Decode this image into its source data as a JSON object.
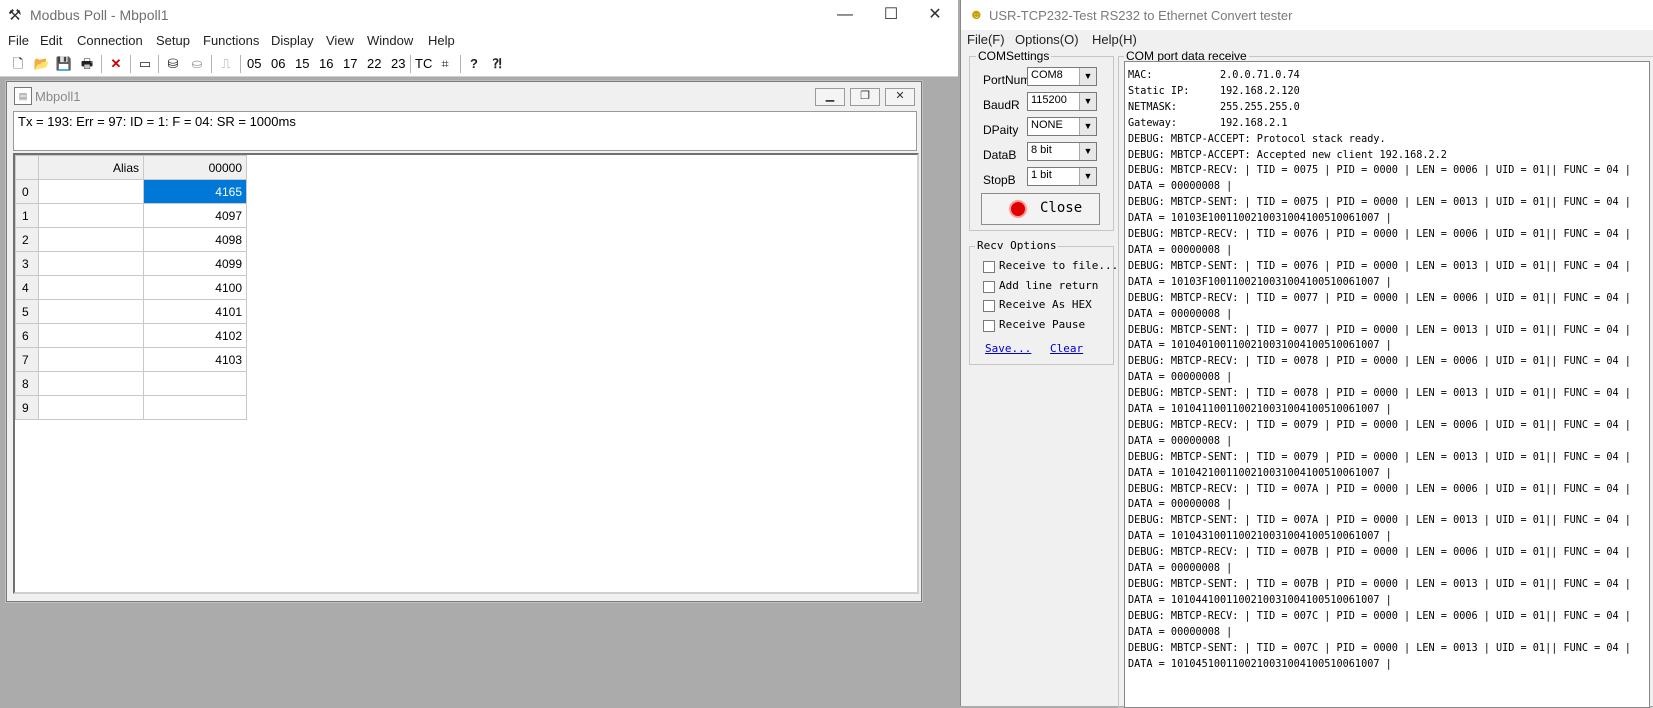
{
  "modbus_poll": {
    "title": "Modbus Poll - Mbpoll1",
    "menu": [
      "File",
      "Edit",
      "Connection",
      "Setup",
      "Functions",
      "Display",
      "View",
      "Window",
      "Help"
    ],
    "toolbar_codes": [
      "05",
      "06",
      "15",
      "16",
      "17",
      "22",
      "23"
    ],
    "toolbar_tc": "TC",
    "child": {
      "title": "Mbpoll1",
      "status": "Tx = 193: Err = 97: ID = 1: F = 04: SR = 1000ms",
      "grid": {
        "headers": [
          "Alias",
          "00000"
        ],
        "rows": [
          {
            "num": "0",
            "alias": "",
            "value": "4165"
          },
          {
            "num": "1",
            "alias": "",
            "value": "4097"
          },
          {
            "num": "2",
            "alias": "",
            "value": "4098"
          },
          {
            "num": "3",
            "alias": "",
            "value": "4099"
          },
          {
            "num": "4",
            "alias": "",
            "value": "4100"
          },
          {
            "num": "5",
            "alias": "",
            "value": "4101"
          },
          {
            "num": "6",
            "alias": "",
            "value": "4102"
          },
          {
            "num": "7",
            "alias": "",
            "value": "4103"
          },
          {
            "num": "8",
            "alias": "",
            "value": ""
          },
          {
            "num": "9",
            "alias": "",
            "value": ""
          }
        ]
      }
    }
  },
  "usr_tcp": {
    "title": "USR-TCP232-Test  RS232 to Ethernet Convert tester",
    "menu": [
      "File(F)",
      "Options(O)",
      "Help(H)"
    ],
    "com_settings": {
      "label": "COMSettings",
      "fields": [
        {
          "label": "PortNum",
          "value": "COM8"
        },
        {
          "label": "BaudR",
          "value": "115200"
        },
        {
          "label": "DPaity",
          "value": "NONE"
        },
        {
          "label": "DataB",
          "value": "8 bit"
        },
        {
          "label": "StopB",
          "value": "1 bit"
        }
      ],
      "close_label": "Close"
    },
    "recv_options": {
      "label": "Recv Options",
      "checkboxes": [
        "Receive to file...",
        "Add line return",
        "Receive As HEX",
        "Receive Pause"
      ],
      "save_link": "Save...",
      "clear_link": "Clear"
    },
    "com_recv": {
      "label": "COM port data receive",
      "lines": [
        "MAC:           2.0.0.71.0.74",
        "Static IP:     192.168.2.120",
        "NETMASK:       255.255.255.0",
        "Gateway:       192.168.2.1",
        "DEBUG: MBTCP-ACCEPT: Protocol stack ready.",
        "DEBUG: MBTCP-ACCEPT: Accepted new client 192.168.2.2",
        "DEBUG: MBTCP-RECV: | TID = 0075 | PID = 0000 | LEN = 0006 | UID = 01|| FUNC = 04 |",
        "DATA = 00000008 |",
        "DEBUG: MBTCP-SENT: | TID = 0075 | PID = 0000 | LEN = 0013 | UID = 01|| FUNC = 04 |",
        "DATA = 10103E1001100210031004100510061007 |",
        "DEBUG: MBTCP-RECV: | TID = 0076 | PID = 0000 | LEN = 0006 | UID = 01|| FUNC = 04 |",
        "DATA = 00000008 |",
        "DEBUG: MBTCP-SENT: | TID = 0076 | PID = 0000 | LEN = 0013 | UID = 01|| FUNC = 04 |",
        "DATA = 10103F1001100210031004100510061007 |",
        "DEBUG: MBTCP-RECV: | TID = 0077 | PID = 0000 | LEN = 0006 | UID = 01|| FUNC = 04 |",
        "DATA = 00000008 |",
        "DEBUG: MBTCP-SENT: | TID = 0077 | PID = 0000 | LEN = 0013 | UID = 01|| FUNC = 04 |",
        "DATA = 1010401001100210031004100510061007 |",
        "DEBUG: MBTCP-RECV: | TID = 0078 | PID = 0000 | LEN = 0006 | UID = 01|| FUNC = 04 |",
        "DATA = 00000008 |",
        "DEBUG: MBTCP-SENT: | TID = 0078 | PID = 0000 | LEN = 0013 | UID = 01|| FUNC = 04 |",
        "DATA = 1010411001100210031004100510061007 |",
        "DEBUG: MBTCP-RECV: | TID = 0079 | PID = 0000 | LEN = 0006 | UID = 01|| FUNC = 04 |",
        "DATA = 00000008 |",
        "DEBUG: MBTCP-SENT: | TID = 0079 | PID = 0000 | LEN = 0013 | UID = 01|| FUNC = 04 |",
        "DATA = 1010421001100210031004100510061007 |",
        "DEBUG: MBTCP-RECV: | TID = 007A | PID = 0000 | LEN = 0006 | UID = 01|| FUNC = 04 |",
        "DATA = 00000008 |",
        "DEBUG: MBTCP-SENT: | TID = 007A | PID = 0000 | LEN = 0013 | UID = 01|| FUNC = 04 |",
        "DATA = 1010431001100210031004100510061007 |",
        "DEBUG: MBTCP-RECV: | TID = 007B | PID = 0000 | LEN = 0006 | UID = 01|| FUNC = 04 |",
        "DATA = 00000008 |",
        "DEBUG: MBTCP-SENT: | TID = 007B | PID = 0000 | LEN = 0013 | UID = 01|| FUNC = 04 |",
        "DATA = 1010441001100210031004100510061007 |",
        "DEBUG: MBTCP-RECV: | TID = 007C | PID = 0000 | LEN = 0006 | UID = 01|| FUNC = 04 |",
        "DATA = 00000008 |",
        "DEBUG: MBTCP-SENT: | TID = 007C | PID = 0000 | LEN = 0013 | UID = 01|| FUNC = 04 |",
        "DATA = 1010451001100210031004100510061007 |"
      ]
    }
  },
  "colors": {
    "selection": "#0078d7",
    "led": "#e00000",
    "link": "#0000cc"
  }
}
